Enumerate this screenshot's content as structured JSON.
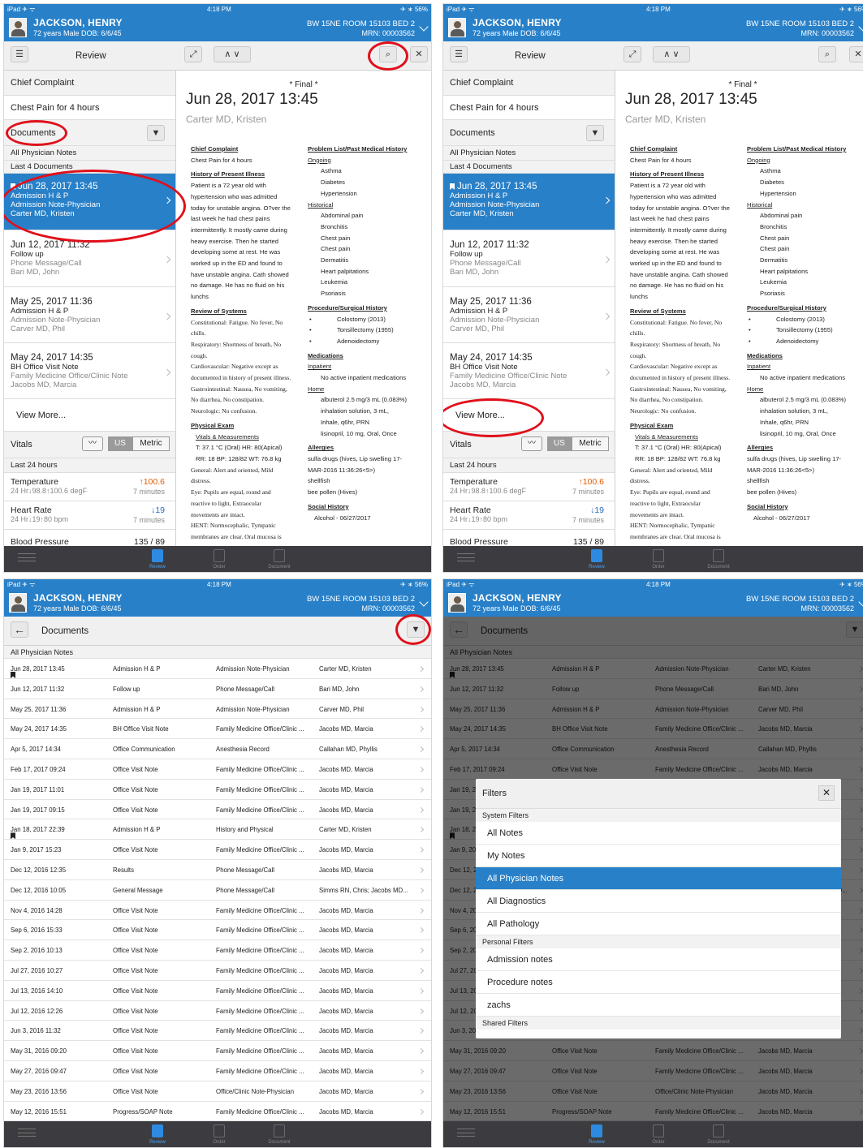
{
  "status": {
    "device": "iPad ✈ ᯤ",
    "time": "4:18 PM",
    "battery": "✈ ∗ 56%"
  },
  "patient": {
    "name": "JACKSON, HENRY",
    "info": "72 years  Male  DOB: 6/6/45",
    "room": "BW 15NE ROOM 15103 BED 2",
    "mrn": "MRN: 00003562"
  },
  "review": {
    "title": "Review",
    "chief_complaint": "Chief Complaint",
    "complaint_value": "Chest Pain for 4 hours",
    "documents": "Documents",
    "all_physician": "All Physician Notes",
    "last4": "Last 4 Documents",
    "view_more": "View More...",
    "docs": [
      {
        "date": "Jun 28, 2017 13:45",
        "type": "Admission H & P",
        "sub": "Admission Note-Physician",
        "author": "Carter MD, Kristen"
      },
      {
        "date": "Jun 12, 2017 11:32",
        "type": "Follow up",
        "sub": "Phone Message/Call",
        "author": "Bari MD, John"
      },
      {
        "date": "May 25, 2017 11:36",
        "type": "Admission H & P",
        "sub": "Admission Note-Physician",
        "author": "Carver MD, Phil"
      },
      {
        "date": "May 24, 2017 14:35",
        "type": "BH Office Visit Note",
        "sub": "Family Medicine Office/Clinic Note",
        "author": "Jacobs MD, Marcia"
      }
    ],
    "vitals": "Vitals",
    "us": "US",
    "metric": "Metric",
    "last24": "Last 24 hours",
    "temp": "Temperature",
    "temp_val": "100.6",
    "temp_range": "24 Hr↓98.8↑100.6 degF",
    "temp_time": "7 minutes",
    "hr": "Heart Rate",
    "hr_val": "19",
    "hr_range": "24 Hr↓19↑80 bpm",
    "hr_time": "7 minutes",
    "bp": "Blood Pressure",
    "bp_val": "135 / 89"
  },
  "note": {
    "final": "* Final *",
    "date": "Jun 28, 2017 13:45",
    "author": "Carter MD, Kristen",
    "cc_h": "Chief Complaint",
    "cc": "Chest Pain for 4 hours",
    "hpi_h": "History of Present Illness",
    "hpi": [
      "Patient is a 72 year old with",
      "hypertension who was admitted",
      "today for unstable angina. O?ver the",
      "last week he had chest pains",
      "intermittently. It mostly came during",
      "heavy exercise. Then he started",
      "developing some at rest. He was",
      "worked up in the ED and found to",
      "have unstable angina. Cath showed",
      "no damage. He has no fluid on his",
      "lunchs"
    ],
    "ros_h": "Review of Systems",
    "ros": [
      "Constitutional: Fatigue. No fever, No",
      "chills.",
      "Respiratory: Shortness of breath, No",
      "cough.",
      "Cardiovascular: Negative except as",
      "documented in history of present illness.",
      "Gastrointestinal: Nausea, No vomiting,",
      "No diarrhea, No constipation.",
      "Neurologic: No confusion."
    ],
    "pe_h": "Physical Exam",
    "vm": "Vitals & Measurements",
    "v1": "T: 37.1 °C (Oral)  HR: 80(Apical)",
    "v2": "RR: 18  BP: 128/82  WT: 76.8 kg",
    "pe": [
      "General: Alert and oriented, Mild",
      "distress.",
      "Eye: Pupils are equal, round and",
      "reactive to light, Extraocular",
      "movements are intact.",
      "HENT: Normocephalic, Tympanic",
      "membranes are clear. Oral mucosa is"
    ],
    "pl_h": "Problem List/Past Medical History",
    "ongoing": "Ongoing",
    "ongoing_items": [
      "Asthma",
      "Diabetes",
      "Hypertension"
    ],
    "historical": "Historical",
    "hist_items": [
      "Abdominal pain",
      "Bronchitis",
      "Chest pain",
      "Chest pain",
      "Dermatitis",
      "Heart palpitations",
      "Leukemia",
      "Psoriasis"
    ],
    "ps_h": "Procedure/Surgical History",
    "ps_items": [
      "Colostomy (2013)",
      "Tonsillectomy (1955)",
      "Adenoidectomy"
    ],
    "med_h": "Medications",
    "inpatient": "Inpatient",
    "no_inpt": "No active inpatient medications",
    "home": "Home",
    "home_meds": [
      "albuterol 2.5 mg/3 mL (0.083%)",
      "inhalation solution, 3 mL,",
      "Inhale, q6hr, PRN",
      "lisinopril, 10 mg, Oral, Once"
    ],
    "all_h": "Allergies",
    "all_items": [
      "sulfa drugs (hives, Lip swelling 17-",
      "MAR-2016 11:36:26<5>)",
      "shellfish",
      "bee pollen (Hives)"
    ],
    "soc_h": "Social History",
    "soc": "Alcohol - 06/27/2017"
  },
  "tabs": {
    "review": "Review",
    "order": "Order",
    "document": "Document"
  },
  "doclist": {
    "title": "Documents",
    "header": "All Physician Notes",
    "rows": [
      [
        "Jun 28, 2017 13:45",
        "Admission H & P",
        "Admission Note-Physician",
        "Carter MD, Kristen"
      ],
      [
        "Jun 12, 2017 11:32",
        "Follow up",
        "Phone Message/Call",
        "Bari MD, John"
      ],
      [
        "May 25, 2017 11:36",
        "Admission H & P",
        "Admission Note-Physician",
        "Carver MD, Phil"
      ],
      [
        "May 24, 2017 14:35",
        "BH Office Visit Note",
        "Family Medicine Office/Clinic ...",
        "Jacobs MD, Marcia"
      ],
      [
        "Apr 5, 2017 14:34",
        "Office Communication",
        "Anesthesia Record",
        "Callahan MD, Phyllis"
      ],
      [
        "Feb 17, 2017 09:24",
        "Office Visit Note",
        "Family Medicine Office/Clinic ...",
        "Jacobs MD, Marcia"
      ],
      [
        "Jan 19, 2017 11:01",
        "Office Visit Note",
        "Family Medicine Office/Clinic ...",
        "Jacobs MD, Marcia"
      ],
      [
        "Jan 19, 2017 09:15",
        "Office Visit Note",
        "Family Medicine Office/Clinic ...",
        "Jacobs MD, Marcia"
      ],
      [
        "Jan 18, 2017 22:39",
        "Admission H & P",
        "History and Physical",
        "Carter MD, Kristen"
      ],
      [
        "Jan 9, 2017 15:23",
        "Office Visit Note",
        "Family Medicine Office/Clinic ...",
        "Jacobs MD, Marcia"
      ],
      [
        "Dec 12, 2016 12:35",
        "Results",
        "Phone Message/Call",
        "Jacobs MD, Marcia"
      ],
      [
        "Dec 12, 2016 10:05",
        "General Message",
        "Phone Message/Call",
        "Simms RN, Chris; Jacobs MD..."
      ],
      [
        "Nov 4, 2016 14:28",
        "Office Visit Note",
        "Family Medicine Office/Clinic ...",
        "Jacobs MD, Marcia"
      ],
      [
        "Sep 6, 2016 15:33",
        "Office Visit Note",
        "Family Medicine Office/Clinic ...",
        "Jacobs MD, Marcia"
      ],
      [
        "Sep 2, 2016 10:13",
        "Office Visit Note",
        "Family Medicine Office/Clinic ...",
        "Jacobs MD, Marcia"
      ],
      [
        "Jul 27, 2016 10:27",
        "Office Visit Note",
        "Family Medicine Office/Clinic ...",
        "Jacobs MD, Marcia"
      ],
      [
        "Jul 13, 2016 14:10",
        "Office Visit Note",
        "Family Medicine Office/Clinic ...",
        "Jacobs MD, Marcia"
      ],
      [
        "Jul 12, 2016 12:26",
        "Office Visit Note",
        "Family Medicine Office/Clinic ...",
        "Jacobs MD, Marcia"
      ],
      [
        "Jun 3, 2016 11:32",
        "Office Visit Note",
        "Family Medicine Office/Clinic ...",
        "Jacobs MD, Marcia"
      ],
      [
        "May 31, 2016 09:20",
        "Office Visit Note",
        "Family Medicine Office/Clinic ...",
        "Jacobs MD, Marcia"
      ],
      [
        "May 27, 2016 09:47",
        "Office Visit Note",
        "Family Medicine Office/Clinic ...",
        "Jacobs MD, Marcia"
      ],
      [
        "May 23, 2016 13:56",
        "Office Visit Note",
        "Office/Clinic Note-Physician",
        "Jacobs MD, Marcia"
      ],
      [
        "May 12, 2016 15:51",
        "Progress/SOAP Note",
        "Family Medicine Office/Clinic ...",
        "Jacobs MD, Marcia"
      ]
    ]
  },
  "filters": {
    "title": "Filters",
    "system": "System Filters",
    "items": [
      "All Notes",
      "My Notes",
      "All Physician Notes",
      "All Diagnostics",
      "All Pathology"
    ],
    "personal": "Personal Filters",
    "pitems": [
      "Admission notes",
      "Procedure notes",
      "zachs"
    ],
    "shared": "Shared Filters"
  },
  "colors": {
    "header": "#2880c8",
    "selected": "#2880c8",
    "annotation": "#e0101a",
    "alert": "#e05a00"
  }
}
